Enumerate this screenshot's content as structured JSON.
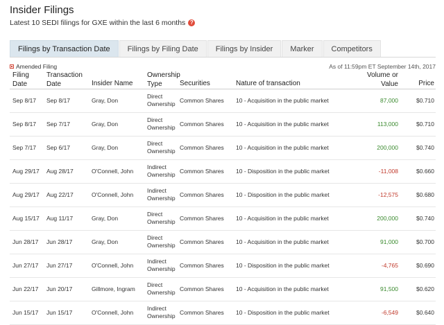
{
  "title": "Insider Filings",
  "subtitle": "Latest 10 SEDI filings for GXE within the last 6 months",
  "help_icon": "?",
  "tabs": [
    {
      "label": "Filings by Transaction Date",
      "active": true
    },
    {
      "label": "Filings by Filing Date",
      "active": false
    },
    {
      "label": "Filings by Insider",
      "active": false
    },
    {
      "label": "Marker",
      "active": false
    },
    {
      "label": "Competitors",
      "active": false
    }
  ],
  "amended_label": "Amended Filing",
  "as_of": "As of 11:59pm ET September 14th, 2017",
  "columns": {
    "filing_date_1": "Filing",
    "filing_date_2": "Date",
    "transaction_date_1": "Transaction",
    "transaction_date_2": "Date",
    "insider_name": "Insider Name",
    "ownership_type_1": "Ownership",
    "ownership_type_2": "Type",
    "securities": "Securities",
    "nature": "Nature of transaction",
    "volume_1": "Volume or",
    "volume_2": "Value",
    "price": "Price"
  },
  "rows": [
    {
      "filing_date": "Sep 8/17",
      "transaction_date": "Sep 8/17",
      "insider": "Gray, Don",
      "own1": "Direct",
      "own2": "Ownership",
      "securities": "Common Shares",
      "nature": "10 - Acquisition in the public market",
      "volume": "87,000",
      "price": "$0.710",
      "sign": "pos"
    },
    {
      "filing_date": "Sep 8/17",
      "transaction_date": "Sep 7/17",
      "insider": "Gray, Don",
      "own1": "Direct",
      "own2": "Ownership",
      "securities": "Common Shares",
      "nature": "10 - Acquisition in the public market",
      "volume": "113,000",
      "price": "$0.710",
      "sign": "pos"
    },
    {
      "filing_date": "Sep 7/17",
      "transaction_date": "Sep 6/17",
      "insider": "Gray, Don",
      "own1": "Direct",
      "own2": "Ownership",
      "securities": "Common Shares",
      "nature": "10 - Acquisition in the public market",
      "volume": "200,000",
      "price": "$0.740",
      "sign": "pos"
    },
    {
      "filing_date": "Aug 29/17",
      "transaction_date": "Aug 28/17",
      "insider": "O'Connell, John",
      "own1": "Indirect",
      "own2": "Ownership",
      "securities": "Common Shares",
      "nature": "10 - Disposition in the public market",
      "volume": "-11,008",
      "price": "$0.660",
      "sign": "neg"
    },
    {
      "filing_date": "Aug 29/17",
      "transaction_date": "Aug 22/17",
      "insider": "O'Connell, John",
      "own1": "Indirect",
      "own2": "Ownership",
      "securities": "Common Shares",
      "nature": "10 - Disposition in the public market",
      "volume": "-12,575",
      "price": "$0.680",
      "sign": "neg"
    },
    {
      "filing_date": "Aug 15/17",
      "transaction_date": "Aug 11/17",
      "insider": "Gray, Don",
      "own1": "Direct",
      "own2": "Ownership",
      "securities": "Common Shares",
      "nature": "10 - Acquisition in the public market",
      "volume": "200,000",
      "price": "$0.740",
      "sign": "pos"
    },
    {
      "filing_date": "Jun 28/17",
      "transaction_date": "Jun 28/17",
      "insider": "Gray, Don",
      "own1": "Direct",
      "own2": "Ownership",
      "securities": "Common Shares",
      "nature": "10 - Acquisition in the public market",
      "volume": "91,000",
      "price": "$0.700",
      "sign": "pos"
    },
    {
      "filing_date": "Jun 27/17",
      "transaction_date": "Jun 27/17",
      "insider": "O'Connell, John",
      "own1": "Indirect",
      "own2": "Ownership",
      "securities": "Common Shares",
      "nature": "10 - Disposition in the public market",
      "volume": "-4,765",
      "price": "$0.690",
      "sign": "neg"
    },
    {
      "filing_date": "Jun 22/17",
      "transaction_date": "Jun 20/17",
      "insider": "Gillmore, Ingram",
      "own1": "Direct",
      "own2": "Ownership",
      "securities": "Common Shares",
      "nature": "10 - Acquisition in the public market",
      "volume": "91,500",
      "price": "$0.620",
      "sign": "pos"
    },
    {
      "filing_date": "Jun 15/17",
      "transaction_date": "Jun 15/17",
      "insider": "O'Connell, John",
      "own1": "Indirect",
      "own2": "Ownership",
      "securities": "Common Shares",
      "nature": "10 - Disposition in the public market",
      "volume": "-6,549",
      "price": "$0.640",
      "sign": "neg"
    }
  ]
}
